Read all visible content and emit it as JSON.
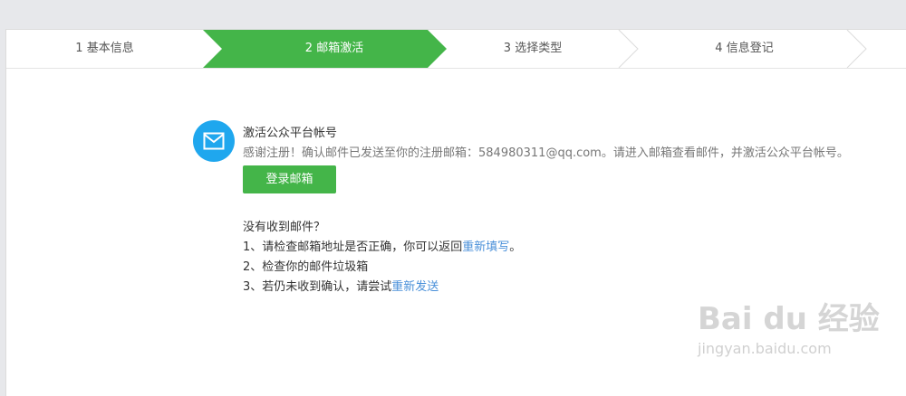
{
  "steps": [
    {
      "label": "1 基本信息",
      "active": false
    },
    {
      "label": "2 邮箱激活",
      "active": true
    },
    {
      "label": "3 选择类型",
      "active": false
    },
    {
      "label": "4 信息登记",
      "active": false
    }
  ],
  "colors": {
    "active_step": "#44b549",
    "icon_bg": "#1fa7ee",
    "link": "#4a90d9"
  },
  "activation": {
    "icon": "mail-icon",
    "title": "激活公众平台帐号",
    "description": "感谢注册！确认邮件已发送至你的注册邮箱：584980311@qq.com。请进入邮箱查看邮件，并激活公众平台帐号。",
    "login_button": "登录邮箱"
  },
  "help": {
    "heading": "没有收到邮件？",
    "item1_prefix": "1、请检查邮箱地址是否正确，你可以返回",
    "item1_link": "重新填写",
    "item1_suffix": "。",
    "item2": "2、检查你的邮件垃圾箱",
    "item3_prefix": "3、若仍未收到确认，请尝试",
    "item3_link": "重新发送"
  },
  "watermark": {
    "main": "Bai du 经验",
    "sub": "jingyan.baidu.com"
  }
}
